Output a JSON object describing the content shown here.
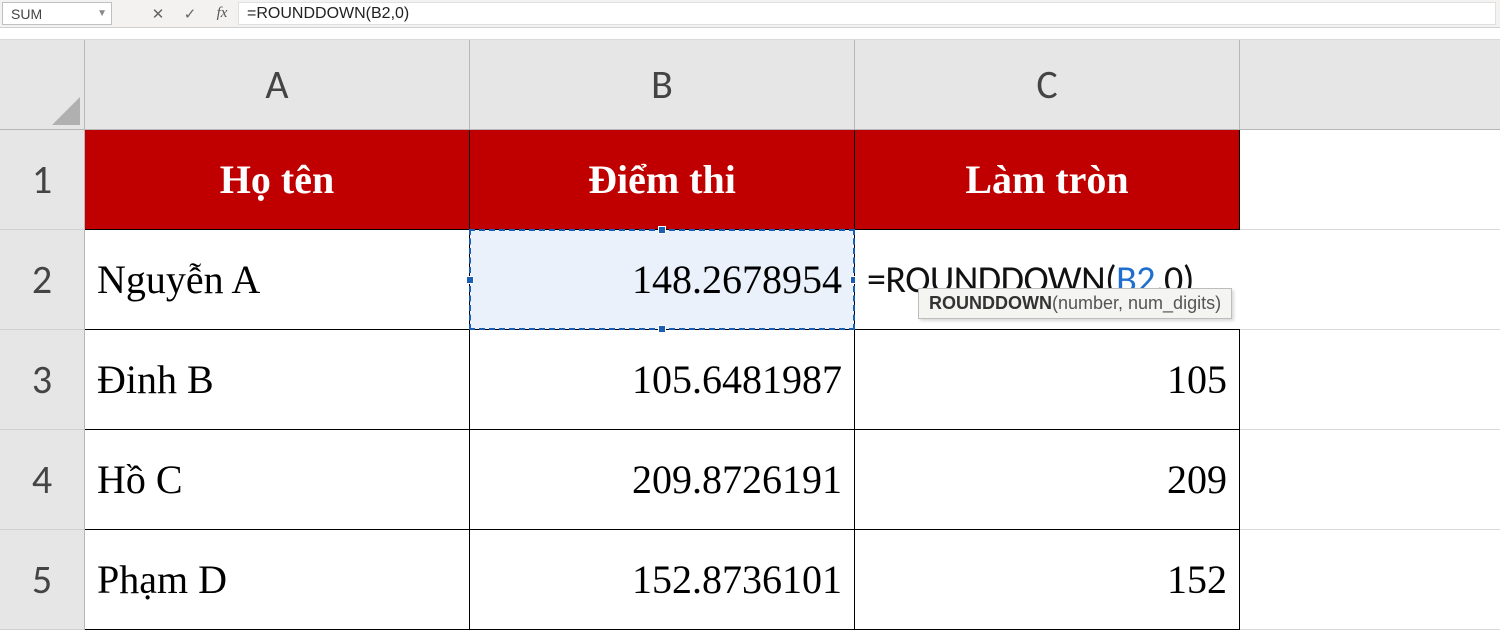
{
  "formula_bar": {
    "name_box": "SUM",
    "cancel_glyph": "✕",
    "enter_glyph": "✓",
    "fx_glyph": "fx",
    "formula": "=ROUNDDOWN(B2,0)"
  },
  "columns": {
    "A": "A",
    "B": "B",
    "C": "C"
  },
  "rows": {
    "r1": "1",
    "r2": "2",
    "r3": "3",
    "r4": "4",
    "r5": "5"
  },
  "headers": {
    "A": "Họ tên",
    "B": "Điểm thi",
    "C": "Làm tròn"
  },
  "data": {
    "r2": {
      "A": "Nguyễn A",
      "B": "148.2678954",
      "C_fn": "=ROUNDDOWN(",
      "C_ref": "B2",
      "C_tail": ",0)"
    },
    "r3": {
      "A": "Đinh B",
      "B": "105.6481987",
      "C": "105"
    },
    "r4": {
      "A": "Hồ C",
      "B": "209.8726191",
      "C": "209"
    },
    "r5": {
      "A": "Phạm D",
      "B": "152.8736101",
      "C": "152"
    }
  },
  "tooltip": {
    "fn": "ROUNDDOWN",
    "args": "(number, num_digits)"
  }
}
